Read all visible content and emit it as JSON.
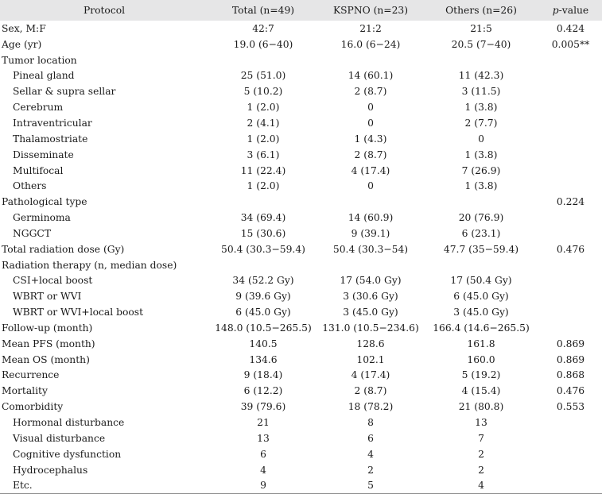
{
  "header": {
    "protocol": "Protocol",
    "total": "Total (n=49)",
    "kspno": "KSPNO (n=23)",
    "others": "Others (n=26)",
    "p_italic": "p",
    "p_rest": "-value"
  },
  "rows": [
    {
      "label": "Sex, M:F",
      "indent": false,
      "total": "42:7",
      "kspno": "21:2",
      "others": "21:5",
      "p": "0.424"
    },
    {
      "label": "Age (yr)",
      "indent": false,
      "total": "19.0 (6−40)",
      "kspno": "16.0 (6−24)",
      "others": "20.5 (7−40)",
      "p": "0.005**"
    },
    {
      "label": "Tumor location",
      "indent": false,
      "total": "",
      "kspno": "",
      "others": "",
      "p": ""
    },
    {
      "label": "Pineal gland",
      "indent": true,
      "total": "25 (51.0)",
      "kspno": "14 (60.1)",
      "others": "11 (42.3)",
      "p": ""
    },
    {
      "label": "Sellar & supra sellar",
      "indent": true,
      "total": "5 (10.2)",
      "kspno": "2 (8.7)",
      "others": "3 (11.5)",
      "p": ""
    },
    {
      "label": "Cerebrum",
      "indent": true,
      "total": "1 (2.0)",
      "kspno": "0",
      "others": "1 (3.8)",
      "p": ""
    },
    {
      "label": "Intraventricular",
      "indent": true,
      "total": "2 (4.1)",
      "kspno": "0",
      "others": "2 (7.7)",
      "p": ""
    },
    {
      "label": "Thalamostriate",
      "indent": true,
      "total": "1 (2.0)",
      "kspno": "1 (4.3)",
      "others": "0",
      "p": ""
    },
    {
      "label": "Disseminate",
      "indent": true,
      "total": "3 (6.1)",
      "kspno": "2 (8.7)",
      "others": "1 (3.8)",
      "p": ""
    },
    {
      "label": "Multifocal",
      "indent": true,
      "total": "11 (22.4)",
      "kspno": "4 (17.4)",
      "others": "7 (26.9)",
      "p": ""
    },
    {
      "label": "Others",
      "indent": true,
      "total": "1 (2.0)",
      "kspno": "0",
      "others": "1 (3.8)",
      "p": ""
    },
    {
      "label": "Pathological type",
      "indent": false,
      "total": "",
      "kspno": "",
      "others": "",
      "p": "0.224"
    },
    {
      "label": "Germinoma",
      "indent": true,
      "total": "34 (69.4)",
      "kspno": "14 (60.9)",
      "others": "20 (76.9)",
      "p": ""
    },
    {
      "label": "NGGCT",
      "indent": true,
      "total": "15 (30.6)",
      "kspno": "9 (39.1)",
      "others": "6 (23.1)",
      "p": ""
    },
    {
      "label": "Total radiation dose (Gy)",
      "indent": false,
      "total": "50.4 (30.3−59.4)",
      "kspno": "50.4 (30.3−54)",
      "others": "47.7 (35−59.4)",
      "p": "0.476"
    },
    {
      "label": "Radiation therapy (n, median dose)",
      "indent": false,
      "total": "",
      "kspno": "",
      "others": "",
      "p": ""
    },
    {
      "label": "CSI+local boost",
      "indent": true,
      "total": "34 (52.2 Gy)",
      "kspno": "17 (54.0 Gy)",
      "others": "17 (50.4 Gy)",
      "p": ""
    },
    {
      "label": "WBRT or WVI",
      "indent": true,
      "total": "9 (39.6 Gy)",
      "kspno": "3 (30.6 Gy)",
      "others": "6 (45.0 Gy)",
      "p": ""
    },
    {
      "label": "WBRT or WVI+local boost",
      "indent": true,
      "total": "6 (45.0 Gy)",
      "kspno": "3 (45.0 Gy)",
      "others": "3 (45.0 Gy)",
      "p": ""
    },
    {
      "label": "Follow-up (month)",
      "indent": false,
      "total": "148.0 (10.5−265.5)",
      "kspno": "131.0 (10.5−234.6)",
      "others": "166.4 (14.6−265.5)",
      "p": ""
    },
    {
      "label": "Mean PFS (month)",
      "indent": false,
      "total": "140.5",
      "kspno": "128.6",
      "others": "161.8",
      "p": "0.869"
    },
    {
      "label": "Mean OS (month)",
      "indent": false,
      "total": "134.6",
      "kspno": "102.1",
      "others": "160.0",
      "p": "0.869"
    },
    {
      "label": "Recurrence",
      "indent": false,
      "total": "9 (18.4)",
      "kspno": "4 (17.4)",
      "others": "5 (19.2)",
      "p": "0.868"
    },
    {
      "label": "Mortality",
      "indent": false,
      "total": "6 (12.2)",
      "kspno": "2 (8.7)",
      "others": "4 (15.4)",
      "p": "0.476"
    },
    {
      "label": "Comorbidity",
      "indent": false,
      "total": "39 (79.6)",
      "kspno": "18 (78.2)",
      "others": "21 (80.8)",
      "p": "0.553"
    },
    {
      "label": "Hormonal disturbance",
      "indent": true,
      "total": "21",
      "kspno": "8",
      "others": "13",
      "p": ""
    },
    {
      "label": "Visual disturbance",
      "indent": true,
      "total": "13",
      "kspno": "6",
      "others": "7",
      "p": ""
    },
    {
      "label": "Cognitive dysfunction",
      "indent": true,
      "total": "6",
      "kspno": "4",
      "others": "2",
      "p": ""
    },
    {
      "label": "Hydrocephalus",
      "indent": true,
      "total": "4",
      "kspno": "2",
      "others": "2",
      "p": ""
    },
    {
      "label": "Etc.",
      "indent": true,
      "total": "9",
      "kspno": "5",
      "others": "4",
      "p": ""
    }
  ]
}
